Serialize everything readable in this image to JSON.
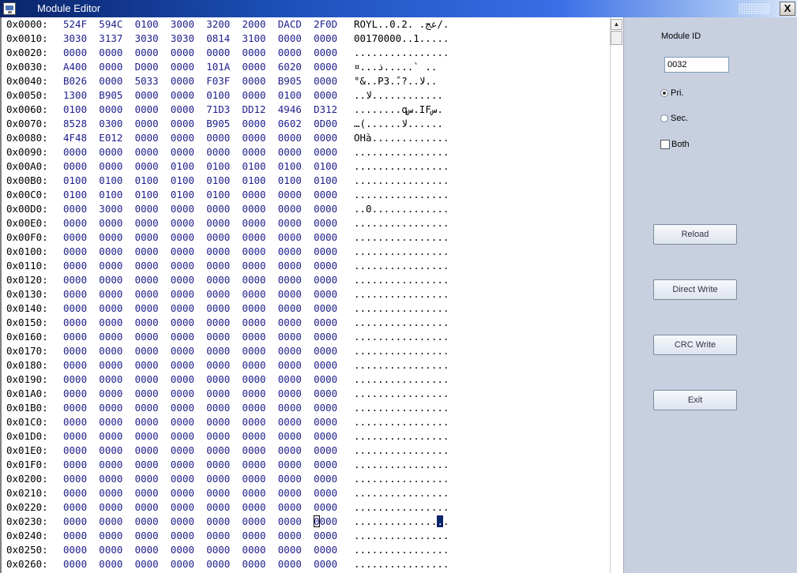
{
  "window": {
    "title": "Module Editor",
    "close_label": "X"
  },
  "hex_rows": [
    {
      "offset": "0x0000:",
      "words": [
        "524F",
        "594C",
        "0100",
        "3000",
        "3200",
        "2000",
        "DACD",
        "2F0D"
      ],
      "ascii": "ROYL..0.2. .عج/."
    },
    {
      "offset": "0x0010:",
      "words": [
        "3030",
        "3137",
        "3030",
        "3030",
        "0814",
        "3100",
        "0000",
        "0000"
      ],
      "ascii": "00170000..1....."
    },
    {
      "offset": "0x0020:",
      "words": [
        "0000",
        "0000",
        "0000",
        "0000",
        "0000",
        "0000",
        "0000",
        "0000"
      ],
      "ascii": "................"
    },
    {
      "offset": "0x0030:",
      "words": [
        "A400",
        "0000",
        "D000",
        "0000",
        "101A",
        "0000",
        "6020",
        "0000"
      ],
      "ascii": "¤...ذ.....` .. "
    },
    {
      "offset": "0x0040:",
      "words": [
        "B026",
        "0000",
        "5033",
        "0000",
        "F03F",
        "0000",
        "B905",
        "0000"
      ],
      "ascii": "°&..P3..ً?..لا.."
    },
    {
      "offset": "0x0050:",
      "words": [
        "1300",
        "B905",
        "0000",
        "0000",
        "0100",
        "0000",
        "0100",
        "0000"
      ],
      "ascii": "..لا............"
    },
    {
      "offset": "0x0060:",
      "words": [
        "0100",
        "0000",
        "0000",
        "0000",
        "71D3",
        "DD12",
        "4946",
        "D312"
      ],
      "ascii": "........qس.IFس."
    },
    {
      "offset": "0x0070:",
      "words": [
        "8528",
        "0300",
        "0000",
        "0000",
        "B905",
        "0000",
        "0602",
        "0D00"
      ],
      "ascii": "…(......لا......"
    },
    {
      "offset": "0x0080:",
      "words": [
        "4F48",
        "E012",
        "0000",
        "0000",
        "0000",
        "0000",
        "0000",
        "0000"
      ],
      "ascii": "OHà............."
    },
    {
      "offset": "0x0090:",
      "words": [
        "0000",
        "0000",
        "0000",
        "0000",
        "0000",
        "0000",
        "0000",
        "0000"
      ],
      "ascii": "................"
    },
    {
      "offset": "0x00A0:",
      "words": [
        "0000",
        "0000",
        "0000",
        "0100",
        "0100",
        "0100",
        "0100",
        "0100"
      ],
      "ascii": "................"
    },
    {
      "offset": "0x00B0:",
      "words": [
        "0100",
        "0100",
        "0100",
        "0100",
        "0100",
        "0100",
        "0100",
        "0100"
      ],
      "ascii": "................"
    },
    {
      "offset": "0x00C0:",
      "words": [
        "0100",
        "0100",
        "0100",
        "0100",
        "0100",
        "0000",
        "0000",
        "0000"
      ],
      "ascii": "................"
    },
    {
      "offset": "0x00D0:",
      "words": [
        "0000",
        "3000",
        "0000",
        "0000",
        "0000",
        "0000",
        "0000",
        "0000"
      ],
      "ascii": "..0............."
    },
    {
      "offset": "0x00E0:",
      "words": [
        "0000",
        "0000",
        "0000",
        "0000",
        "0000",
        "0000",
        "0000",
        "0000"
      ],
      "ascii": "................"
    },
    {
      "offset": "0x00F0:",
      "words": [
        "0000",
        "0000",
        "0000",
        "0000",
        "0000",
        "0000",
        "0000",
        "0000"
      ],
      "ascii": "................"
    },
    {
      "offset": "0x0100:",
      "words": [
        "0000",
        "0000",
        "0000",
        "0000",
        "0000",
        "0000",
        "0000",
        "0000"
      ],
      "ascii": "................"
    },
    {
      "offset": "0x0110:",
      "words": [
        "0000",
        "0000",
        "0000",
        "0000",
        "0000",
        "0000",
        "0000",
        "0000"
      ],
      "ascii": "................"
    },
    {
      "offset": "0x0120:",
      "words": [
        "0000",
        "0000",
        "0000",
        "0000",
        "0000",
        "0000",
        "0000",
        "0000"
      ],
      "ascii": "................"
    },
    {
      "offset": "0x0130:",
      "words": [
        "0000",
        "0000",
        "0000",
        "0000",
        "0000",
        "0000",
        "0000",
        "0000"
      ],
      "ascii": "................"
    },
    {
      "offset": "0x0140:",
      "words": [
        "0000",
        "0000",
        "0000",
        "0000",
        "0000",
        "0000",
        "0000",
        "0000"
      ],
      "ascii": "................"
    },
    {
      "offset": "0x0150:",
      "words": [
        "0000",
        "0000",
        "0000",
        "0000",
        "0000",
        "0000",
        "0000",
        "0000"
      ],
      "ascii": "................"
    },
    {
      "offset": "0x0160:",
      "words": [
        "0000",
        "0000",
        "0000",
        "0000",
        "0000",
        "0000",
        "0000",
        "0000"
      ],
      "ascii": "................"
    },
    {
      "offset": "0x0170:",
      "words": [
        "0000",
        "0000",
        "0000",
        "0000",
        "0000",
        "0000",
        "0000",
        "0000"
      ],
      "ascii": "................"
    },
    {
      "offset": "0x0180:",
      "words": [
        "0000",
        "0000",
        "0000",
        "0000",
        "0000",
        "0000",
        "0000",
        "0000"
      ],
      "ascii": "................"
    },
    {
      "offset": "0x0190:",
      "words": [
        "0000",
        "0000",
        "0000",
        "0000",
        "0000",
        "0000",
        "0000",
        "0000"
      ],
      "ascii": "................"
    },
    {
      "offset": "0x01A0:",
      "words": [
        "0000",
        "0000",
        "0000",
        "0000",
        "0000",
        "0000",
        "0000",
        "0000"
      ],
      "ascii": "................"
    },
    {
      "offset": "0x01B0:",
      "words": [
        "0000",
        "0000",
        "0000",
        "0000",
        "0000",
        "0000",
        "0000",
        "0000"
      ],
      "ascii": "................"
    },
    {
      "offset": "0x01C0:",
      "words": [
        "0000",
        "0000",
        "0000",
        "0000",
        "0000",
        "0000",
        "0000",
        "0000"
      ],
      "ascii": "................"
    },
    {
      "offset": "0x01D0:",
      "words": [
        "0000",
        "0000",
        "0000",
        "0000",
        "0000",
        "0000",
        "0000",
        "0000"
      ],
      "ascii": "................"
    },
    {
      "offset": "0x01E0:",
      "words": [
        "0000",
        "0000",
        "0000",
        "0000",
        "0000",
        "0000",
        "0000",
        "0000"
      ],
      "ascii": "................"
    },
    {
      "offset": "0x01F0:",
      "words": [
        "0000",
        "0000",
        "0000",
        "0000",
        "0000",
        "0000",
        "0000",
        "0000"
      ],
      "ascii": "................"
    },
    {
      "offset": "0x0200:",
      "words": [
        "0000",
        "0000",
        "0000",
        "0000",
        "0000",
        "0000",
        "0000",
        "0000"
      ],
      "ascii": "................"
    },
    {
      "offset": "0x0210:",
      "words": [
        "0000",
        "0000",
        "0000",
        "0000",
        "0000",
        "0000",
        "0000",
        "0000"
      ],
      "ascii": "................"
    },
    {
      "offset": "0x0220:",
      "words": [
        "0000",
        "0000",
        "0000",
        "0000",
        "0000",
        "0000",
        "0000",
        "0000"
      ],
      "ascii": "................"
    },
    {
      "offset": "0x0230:",
      "words": [
        "0000",
        "0000",
        "0000",
        "0000",
        "0000",
        "0000",
        "0000",
        "0000"
      ],
      "ascii": "................",
      "cursor_word": 7,
      "selected_char": 14
    },
    {
      "offset": "0x0240:",
      "words": [
        "0000",
        "0000",
        "0000",
        "0000",
        "0000",
        "0000",
        "0000",
        "0000"
      ],
      "ascii": "................"
    },
    {
      "offset": "0x0250:",
      "words": [
        "0000",
        "0000",
        "0000",
        "0000",
        "0000",
        "0000",
        "0000",
        "0000"
      ],
      "ascii": "................"
    },
    {
      "offset": "0x0260:",
      "words": [
        "0000",
        "0000",
        "0000",
        "0000",
        "0000",
        "0000",
        "0000",
        "0000"
      ],
      "ascii": "................"
    }
  ],
  "side_panel": {
    "module_id_label": "Module ID",
    "module_id_value": "0032",
    "radio_pri": "Pri.",
    "radio_sec": "Sec.",
    "both_label": "Both",
    "pri_checked": true,
    "sec_checked": false,
    "both_checked": false,
    "buttons": {
      "reload": "Reload",
      "direct_write": "Direct Write",
      "crc_write": "CRC Write",
      "exit": "Exit"
    }
  },
  "colors": {
    "hex_bytes": "#1e1e8c",
    "side_panel_bg": "#c8d0e0",
    "titlebar": "#0a246a"
  },
  "icons": {
    "app": "app-icon",
    "close": "close-icon"
  }
}
